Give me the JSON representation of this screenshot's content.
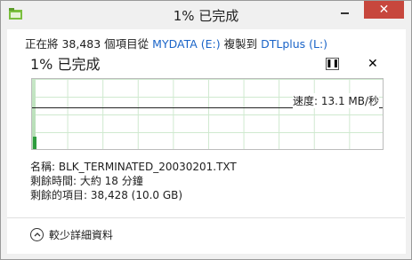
{
  "window": {
    "title": "1% 已完成"
  },
  "titlebar": {
    "minimize_glyph": "—",
    "close_glyph": "✕"
  },
  "summary": {
    "prefix": "正在將 38,483 個項目從 ",
    "source": "MYDATA (E:)",
    "middle": " 複製到 ",
    "destination": "DTLplus (L:)"
  },
  "progress": {
    "title": "1% 已完成",
    "percent": 1,
    "speed_label": "速度: 13.1 MB/秒"
  },
  "controls": {
    "pause_glyph": "❚❚",
    "stop_glyph": "✕"
  },
  "details": {
    "name": "名稱: BLK_TERMINATED_20030201.TXT",
    "time_remaining": "剩餘時間: 大約 18 分鐘",
    "items_remaining": "剩餘的項目: 38,428 (10.0 GB)"
  },
  "footer": {
    "fewer_details_label": "較少詳細資料"
  },
  "colors": {
    "link": "#1a64c8",
    "close_button": "#c7473d",
    "graph_grid": "#cfe9cf",
    "graph_fill": "#2e9c3e"
  },
  "icons": {
    "app": "folder-copy-icon",
    "chevron": "chevron-up-icon"
  }
}
